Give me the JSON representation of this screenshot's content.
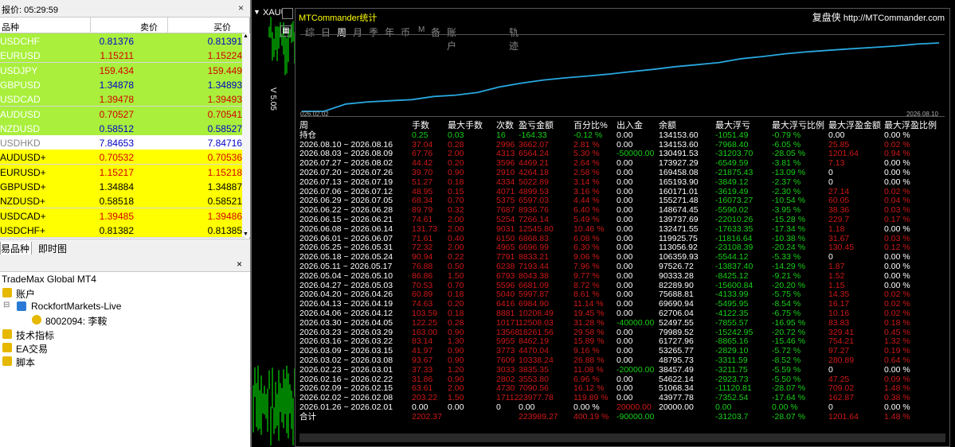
{
  "market_watch": {
    "title": "报价: 05:29:59",
    "headers": {
      "symbol": "品种",
      "bid": "卖价",
      "ask": "买价"
    },
    "rows": [
      {
        "symbol": "USDCHF",
        "bid": "0.81376",
        "ask": "0.81391",
        "bg": "#a9ef3c",
        "bid_color": "#0000c8",
        "ask_color": "#0000c8",
        "sym_color": "#ffffff"
      },
      {
        "symbol": "EURUSD",
        "bid": "1.15211",
        "ask": "1.15224",
        "bg": "#a9ef3c",
        "bid_color": "#d40000",
        "ask_color": "#d40000",
        "sym_color": "#ffffff"
      },
      {
        "symbol": "USDJPY",
        "bid": "159.434",
        "ask": "159.449",
        "bg": "#a9ef3c",
        "bid_color": "#d40000",
        "ask_color": "#d40000",
        "sym_color": "#ffffff"
      },
      {
        "symbol": "GBPUSD",
        "bid": "1.34878",
        "ask": "1.34893",
        "bg": "#a9ef3c",
        "bid_color": "#0000c8",
        "ask_color": "#0000c8",
        "sym_color": "#ffffff"
      },
      {
        "symbol": "USDCAD",
        "bid": "1.39478",
        "ask": "1.39493",
        "bg": "#a9ef3c",
        "bid_color": "#d40000",
        "ask_color": "#d40000",
        "sym_color": "#ffffff"
      },
      {
        "symbol": "AUDUSD",
        "bid": "0.70527",
        "ask": "0.70541",
        "bg": "#a9ef3c",
        "bid_color": "#d40000",
        "ask_color": "#d40000",
        "sym_color": "#ffffff"
      },
      {
        "symbol": "NZDUSD",
        "bid": "0.58512",
        "ask": "0.58527",
        "bg": "#a9ef3c",
        "bid_color": "#0000c8",
        "ask_color": "#0000c8",
        "sym_color": "#ffffff"
      },
      {
        "symbol": "USDHKD",
        "bid": "7.84653",
        "ask": "7.84716",
        "bg": "#ffffff",
        "bid_color": "#0000c8",
        "ask_color": "#0000c8",
        "sym_color": "#888888"
      },
      {
        "symbol": "AUDUSD+",
        "bid": "0.70532",
        "ask": "0.70536",
        "bg": "#ffff00",
        "bid_color": "#d40000",
        "ask_color": "#d40000",
        "sym_color": "#000000"
      },
      {
        "symbol": "EURUSD+",
        "bid": "1.15217",
        "ask": "1.15218",
        "bg": "#ffff00",
        "bid_color": "#d40000",
        "ask_color": "#d40000",
        "sym_color": "#000000"
      },
      {
        "symbol": "GBPUSD+",
        "bid": "1.34884",
        "ask": "1.34887",
        "bg": "#ffff00",
        "bid_color": "#000000",
        "ask_color": "#000000",
        "sym_color": "#000000"
      },
      {
        "symbol": "NZDUSD+",
        "bid": "0.58518",
        "ask": "0.58521",
        "bg": "#ffff00",
        "bid_color": "#000000",
        "ask_color": "#000000",
        "sym_color": "#000000"
      },
      {
        "symbol": "USDCAD+",
        "bid": "1.39485",
        "ask": "1.39486",
        "bg": "#ffff00",
        "bid_color": "#d40000",
        "ask_color": "#d40000",
        "sym_color": "#000000"
      },
      {
        "symbol": "USDCHF+",
        "bid": "0.81382",
        "ask": "0.81385",
        "bg": "#ffff00",
        "bid_color": "#000000",
        "ask_color": "#000000",
        "sym_color": "#000000"
      }
    ],
    "tabs": [
      "易品种",
      "即时图"
    ]
  },
  "navigator": {
    "root": "TradeMax Global MT4",
    "accounts": "账户",
    "server": "RockfortMarkets-Live",
    "account": "8002094: 李鞍",
    "indicators": "技术指标",
    "ea": "EA交易",
    "scripts": "脚本"
  },
  "chart": {
    "symbol": "XAUU",
    "version": "V 5.05"
  },
  "mtc": {
    "title": "MTCommander统计",
    "brand_zh": "复盘侠",
    "brand_url": "http://MTCommander.com",
    "tabs": [
      "综",
      "日",
      "周",
      "月",
      "季",
      "年",
      "币",
      "M",
      "备",
      "账户",
      "轨迹"
    ],
    "active_tab": "周",
    "date_start": "026.02.02",
    "date_end": "2026.08.10",
    "headers": [
      "周",
      "手数",
      "最大手数",
      "次数",
      "盈亏金额",
      "百分比%",
      "出入金",
      "余额",
      "最大浮亏",
      "最大浮亏比例",
      "最大浮盈金额",
      "最大浮盈比例"
    ],
    "holding": {
      "label": "持仓",
      "lots": "0.25",
      "max_lots": "0.03",
      "count": "16",
      "pnl": "-164.33",
      "pct": "-0.12 %",
      "flow": "0.00",
      "balance": "134153.60",
      "max_dd": "-1051.49",
      "dd_pct": "-0.79 %",
      "max_fp": "0.00",
      "fp_pct": "0.00 %"
    },
    "rows": [
      [
        "2026.08.10 ~ 2026.08.16",
        "37.04",
        "0.28",
        "2996",
        "3662.07",
        "2.81 %",
        "0.00",
        "134153.60",
        "-7968.40",
        "-6.05 %",
        "25.85",
        "0.02 %"
      ],
      [
        "2026.08.03 ~ 2026.08.09",
        "67.76",
        "2.00",
        "4313",
        "6564.24",
        "5.30 %",
        "-50000.00",
        "130491.53",
        "-31203.70",
        "-28.05 %",
        "1201.64",
        "0.94 %"
      ],
      [
        "2026.07.27 ~ 2026.08.02",
        "44.42",
        "0.20",
        "3596",
        "4469.21",
        "2.64 %",
        "0.00",
        "173927.29",
        "-6549.59",
        "-3.81 %",
        "7.13",
        "0.00 %"
      ],
      [
        "2026.07.20 ~ 2026.07.26",
        "39.70",
        "0.90",
        "2910",
        "4264.18",
        "2.58 %",
        "0.00",
        "169458.08",
        "-21875.43",
        "-13.09 %",
        "0",
        "0.00 %"
      ],
      [
        "2026.07.13 ~ 2026.07.19",
        "51.27",
        "0.18",
        "4334",
        "5022.89",
        "3.14 %",
        "0.00",
        "165193.90",
        "-3849.12",
        "-2.37 %",
        "0",
        "0.00 %"
      ],
      [
        "2026.07.06 ~ 2026.07.12",
        "48.95",
        "0.15",
        "4071",
        "4899.53",
        "3.16 %",
        "0.00",
        "160171.01",
        "-3619.49",
        "-2.30 %",
        "27.14",
        "0.02 %"
      ],
      [
        "2026.06.29 ~ 2026.07.05",
        "68.34",
        "0.70",
        "5375",
        "6597.03",
        "4.44 %",
        "0.00",
        "155271.48",
        "-16073.27",
        "-10.54 %",
        "60.05",
        "0.04 %"
      ],
      [
        "2026.06.22 ~ 2026.06.28",
        "89.79",
        "0.32",
        "7687",
        "8936.76",
        "6.40 %",
        "0.00",
        "148674.45",
        "-5590.02",
        "-3.95 %",
        "38.36",
        "0.03 %"
      ],
      [
        "2026.06.15 ~ 2026.06.21",
        "74.61",
        "2.00",
        "5254",
        "7266.14",
        "5.49 %",
        "0.00",
        "139737.69",
        "-22010.26",
        "-15.28 %",
        "229.7",
        "0.17 %"
      ],
      [
        "2026.06.08 ~ 2026.06.14",
        "131.73",
        "2.00",
        "9031",
        "12545.80",
        "10.46 %",
        "0.00",
        "132471.55",
        "-17633.35",
        "-17.34 %",
        "1.18",
        "0.00 %"
      ],
      [
        "2026.06.01 ~ 2026.06.07",
        "71.61",
        "0.40",
        "6150",
        "6868.83",
        "6.08 %",
        "0.00",
        "119925.75",
        "-11816.64",
        "-10.38 %",
        "31.67",
        "0.03 %"
      ],
      [
        "2026.05.25 ~ 2026.05.31",
        "72.32",
        "2.00",
        "4965",
        "6696.99",
        "6.30 %",
        "0.00",
        "113056.92",
        "-23108.39",
        "-20.24 %",
        "130.45",
        "0.12 %"
      ],
      [
        "2026.05.18 ~ 2026.05.24",
        "90.94",
        "0.22",
        "7791",
        "8833.21",
        "9.06 %",
        "0.00",
        "106359.93",
        "-5544.12",
        "-5.33 %",
        "0",
        "0.00 %"
      ],
      [
        "2026.05.11 ~ 2026.05.17",
        "76.88",
        "0.50",
        "6238",
        "7193.44",
        "7.96 %",
        "0.00",
        "97526.72",
        "-13837.40",
        "-14.29 %",
        "1.87",
        "0.00 %"
      ],
      [
        "2026.05.04 ~ 2026.05.10",
        "86.86",
        "1.50",
        "6793",
        "8043.38",
        "9.77 %",
        "0.00",
        "90333.28",
        "-8425.12",
        "-9.21 %",
        "1.52",
        "0.00 %"
      ],
      [
        "2026.04.27 ~ 2026.05.03",
        "70.53",
        "0.70",
        "5596",
        "6681.09",
        "8.72 %",
        "0.00",
        "82289.90",
        "-15600.84",
        "-20.20 %",
        "1.15",
        "0.00 %"
      ],
      [
        "2026.04.20 ~ 2026.04.26",
        "60.89",
        "0.18",
        "5040",
        "5997.87",
        "8.61 %",
        "0.00",
        "75688.81",
        "-4133.99",
        "-5.75 %",
        "14.35",
        "0.02 %"
      ],
      [
        "2026.04.13 ~ 2026.04.19",
        "74.63",
        "0.20",
        "6416",
        "6984.90",
        "11.14 %",
        "0.00",
        "69690.94",
        "-5495.95",
        "-8.54 %",
        "16.17",
        "0.02 %"
      ],
      [
        "2026.04.06 ~ 2026.04.12",
        "103.59",
        "0.18",
        "8881",
        "10208.49",
        "19.45 %",
        "0.00",
        "62706.04",
        "-4122.35",
        "-6.75 %",
        "10.16",
        "0.02 %"
      ],
      [
        "2026.03.30 ~ 2026.04.05",
        "122.25",
        "0.28",
        "10171",
        "12508.03",
        "31.28 %",
        "-40000.00",
        "52497.55",
        "-7855.57",
        "-16.95 %",
        "83.83",
        "0.18 %"
      ],
      [
        "2026.03.23 ~ 2026.03.29",
        "163.00",
        "0.90",
        "13568",
        "18261.56",
        "29.58 %",
        "0.00",
        "79989.52",
        "-15242.95",
        "-20.72 %",
        "329.41",
        "0.45 %"
      ],
      [
        "2026.03.16 ~ 2026.03.22",
        "83.14",
        "1.30",
        "5955",
        "8462.19",
        "15.89 %",
        "0.00",
        "61727.96",
        "-8865.16",
        "-15.46 %",
        "754.21",
        "1.32 %"
      ],
      [
        "2026.03.09 ~ 2026.03.15",
        "41.97",
        "0.90",
        "3773",
        "4470.04",
        "9.16 %",
        "0.00",
        "53265.77",
        "-2829.10",
        "-5.72 %",
        "97.27",
        "0.19 %"
      ],
      [
        "2026.03.02 ~ 2026.03.08",
        "93.67",
        "0.90",
        "7609",
        "10338.24",
        "26.88 %",
        "0.00",
        "48795.73",
        "-3311.59",
        "-8.52 %",
        "280.89",
        "0.64 %"
      ],
      [
        "2026.02.23 ~ 2026.03.01",
        "37.33",
        "1.20",
        "3033",
        "3835.35",
        "11.08 %",
        "-20000.00",
        "38457.49",
        "-3211.75",
        "-5.59 %",
        "0",
        "0.00 %"
      ],
      [
        "2026.02.16 ~ 2026.02.22",
        "31.86",
        "0.90",
        "2802",
        "3553.80",
        "6.96 %",
        "0.00",
        "54622.14",
        "-2923.73",
        "-5.50 %",
        "47.25",
        "0.09 %"
      ],
      [
        "2026.02.09 ~ 2026.02.15",
        "63.61",
        "2.00",
        "4730",
        "7090.56",
        "16.12 %",
        "0.00",
        "51068.34",
        "-11120.81",
        "-28.07 %",
        "709.02",
        "1.48 %"
      ],
      [
        "2026.02.02 ~ 2026.02.08",
        "203.22",
        "1.50",
        "17112",
        "23977.78",
        "119.89 %",
        "0.00",
        "43977.78",
        "-7352.54",
        "-17.64 %",
        "162.87",
        "0.38 %"
      ],
      [
        "2026.01.26 ~ 2026.02.01",
        "0.00",
        "0.00",
        "0",
        "0.00",
        "0.00 %",
        "20000.00",
        "20000.00",
        "0.00",
        "0.00 %",
        "0",
        "0.00 %"
      ]
    ],
    "total": {
      "label": "合计",
      "lots": "2202.37",
      "pnl": "223989.27",
      "pct": "400.19 %",
      "flow": "-90000.00",
      "max_dd": "-31203.7",
      "dd_pct": "-28.07 %",
      "max_fp": "1201.64",
      "fp_pct": "1.48 %"
    },
    "colors": {
      "curve": "#29a8e0",
      "pnl": "#d01818",
      "loss": "#18d018",
      "white": "#ffffff",
      "yellow": "#ffff00"
    }
  },
  "curve_data": {
    "type": "line",
    "values": [
      20000,
      43977.78,
      51068.34,
      54622.14,
      38457.49,
      48795.73,
      53265.77,
      61727.96,
      79989.52,
      52497.55,
      62706.04,
      69690.94,
      75688.81,
      82289.9,
      90333.28,
      97526.72,
      106359.93,
      113056.92,
      119925.75,
      132471.55,
      139737.69,
      148674.45,
      155271.48,
      160171.01,
      165193.9,
      169458.08,
      173927.29,
      130491.53,
      134153.6
    ]
  }
}
